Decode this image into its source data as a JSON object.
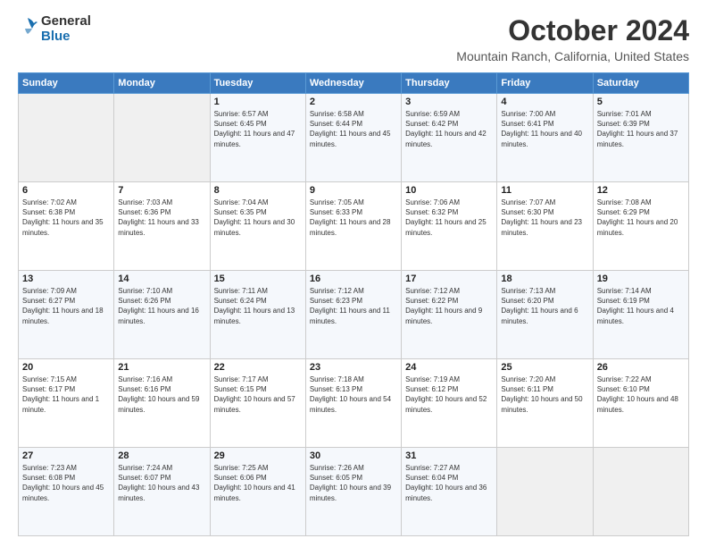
{
  "header": {
    "logo_general": "General",
    "logo_blue": "Blue",
    "month_title": "October 2024",
    "location": "Mountain Ranch, California, United States"
  },
  "days_of_week": [
    "Sunday",
    "Monday",
    "Tuesday",
    "Wednesday",
    "Thursday",
    "Friday",
    "Saturday"
  ],
  "weeks": [
    [
      {
        "day": "",
        "info": ""
      },
      {
        "day": "",
        "info": ""
      },
      {
        "day": "1",
        "info": "Sunrise: 6:57 AM\nSunset: 6:45 PM\nDaylight: 11 hours and 47 minutes."
      },
      {
        "day": "2",
        "info": "Sunrise: 6:58 AM\nSunset: 6:44 PM\nDaylight: 11 hours and 45 minutes."
      },
      {
        "day": "3",
        "info": "Sunrise: 6:59 AM\nSunset: 6:42 PM\nDaylight: 11 hours and 42 minutes."
      },
      {
        "day": "4",
        "info": "Sunrise: 7:00 AM\nSunset: 6:41 PM\nDaylight: 11 hours and 40 minutes."
      },
      {
        "day": "5",
        "info": "Sunrise: 7:01 AM\nSunset: 6:39 PM\nDaylight: 11 hours and 37 minutes."
      }
    ],
    [
      {
        "day": "6",
        "info": "Sunrise: 7:02 AM\nSunset: 6:38 PM\nDaylight: 11 hours and 35 minutes."
      },
      {
        "day": "7",
        "info": "Sunrise: 7:03 AM\nSunset: 6:36 PM\nDaylight: 11 hours and 33 minutes."
      },
      {
        "day": "8",
        "info": "Sunrise: 7:04 AM\nSunset: 6:35 PM\nDaylight: 11 hours and 30 minutes."
      },
      {
        "day": "9",
        "info": "Sunrise: 7:05 AM\nSunset: 6:33 PM\nDaylight: 11 hours and 28 minutes."
      },
      {
        "day": "10",
        "info": "Sunrise: 7:06 AM\nSunset: 6:32 PM\nDaylight: 11 hours and 25 minutes."
      },
      {
        "day": "11",
        "info": "Sunrise: 7:07 AM\nSunset: 6:30 PM\nDaylight: 11 hours and 23 minutes."
      },
      {
        "day": "12",
        "info": "Sunrise: 7:08 AM\nSunset: 6:29 PM\nDaylight: 11 hours and 20 minutes."
      }
    ],
    [
      {
        "day": "13",
        "info": "Sunrise: 7:09 AM\nSunset: 6:27 PM\nDaylight: 11 hours and 18 minutes."
      },
      {
        "day": "14",
        "info": "Sunrise: 7:10 AM\nSunset: 6:26 PM\nDaylight: 11 hours and 16 minutes."
      },
      {
        "day": "15",
        "info": "Sunrise: 7:11 AM\nSunset: 6:24 PM\nDaylight: 11 hours and 13 minutes."
      },
      {
        "day": "16",
        "info": "Sunrise: 7:12 AM\nSunset: 6:23 PM\nDaylight: 11 hours and 11 minutes."
      },
      {
        "day": "17",
        "info": "Sunrise: 7:12 AM\nSunset: 6:22 PM\nDaylight: 11 hours and 9 minutes."
      },
      {
        "day": "18",
        "info": "Sunrise: 7:13 AM\nSunset: 6:20 PM\nDaylight: 11 hours and 6 minutes."
      },
      {
        "day": "19",
        "info": "Sunrise: 7:14 AM\nSunset: 6:19 PM\nDaylight: 11 hours and 4 minutes."
      }
    ],
    [
      {
        "day": "20",
        "info": "Sunrise: 7:15 AM\nSunset: 6:17 PM\nDaylight: 11 hours and 1 minute."
      },
      {
        "day": "21",
        "info": "Sunrise: 7:16 AM\nSunset: 6:16 PM\nDaylight: 10 hours and 59 minutes."
      },
      {
        "day": "22",
        "info": "Sunrise: 7:17 AM\nSunset: 6:15 PM\nDaylight: 10 hours and 57 minutes."
      },
      {
        "day": "23",
        "info": "Sunrise: 7:18 AM\nSunset: 6:13 PM\nDaylight: 10 hours and 54 minutes."
      },
      {
        "day": "24",
        "info": "Sunrise: 7:19 AM\nSunset: 6:12 PM\nDaylight: 10 hours and 52 minutes."
      },
      {
        "day": "25",
        "info": "Sunrise: 7:20 AM\nSunset: 6:11 PM\nDaylight: 10 hours and 50 minutes."
      },
      {
        "day": "26",
        "info": "Sunrise: 7:22 AM\nSunset: 6:10 PM\nDaylight: 10 hours and 48 minutes."
      }
    ],
    [
      {
        "day": "27",
        "info": "Sunrise: 7:23 AM\nSunset: 6:08 PM\nDaylight: 10 hours and 45 minutes."
      },
      {
        "day": "28",
        "info": "Sunrise: 7:24 AM\nSunset: 6:07 PM\nDaylight: 10 hours and 43 minutes."
      },
      {
        "day": "29",
        "info": "Sunrise: 7:25 AM\nSunset: 6:06 PM\nDaylight: 10 hours and 41 minutes."
      },
      {
        "day": "30",
        "info": "Sunrise: 7:26 AM\nSunset: 6:05 PM\nDaylight: 10 hours and 39 minutes."
      },
      {
        "day": "31",
        "info": "Sunrise: 7:27 AM\nSunset: 6:04 PM\nDaylight: 10 hours and 36 minutes."
      },
      {
        "day": "",
        "info": ""
      },
      {
        "day": "",
        "info": ""
      }
    ]
  ]
}
